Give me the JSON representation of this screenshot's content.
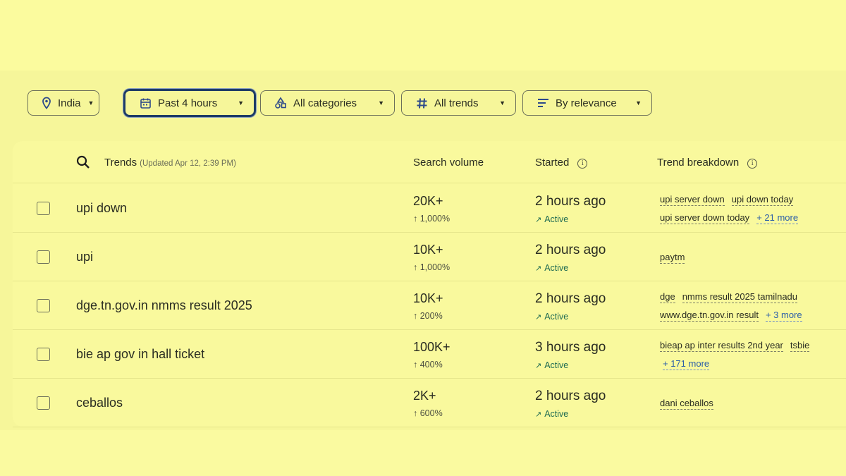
{
  "filters": {
    "location": "India",
    "time": "Past 4 hours",
    "category": "All categories",
    "trends": "All trends",
    "sort": "By relevance"
  },
  "table": {
    "headers": {
      "trends": "Trends",
      "updated": "(Updated Apr 12, 2:39 PM)",
      "search_volume": "Search volume",
      "started": "Started",
      "breakdown": "Trend breakdown"
    },
    "rows": [
      {
        "term": "upi down",
        "volume": "20K+",
        "pct": "↑ 1,000%",
        "started": "2 hours ago",
        "status": "Active",
        "breakdown_line1": [
          "upi server down",
          "upi down today"
        ],
        "breakdown_line2": [
          "upi server down today"
        ],
        "more": "+ 21 more"
      },
      {
        "term": "upi",
        "volume": "10K+",
        "pct": "↑ 1,000%",
        "started": "2 hours ago",
        "status": "Active",
        "breakdown_line1": [
          "paytm"
        ],
        "breakdown_line2": [],
        "more": ""
      },
      {
        "term": "dge.tn.gov.in nmms result 2025",
        "volume": "10K+",
        "pct": "↑ 200%",
        "started": "2 hours ago",
        "status": "Active",
        "breakdown_line1": [
          "dge",
          "nmms result 2025 tamilnadu"
        ],
        "breakdown_line2": [
          "www.dge.tn.gov.in result"
        ],
        "more": "+ 3 more"
      },
      {
        "term": "bie ap gov in hall ticket",
        "volume": "100K+",
        "pct": "↑ 400%",
        "started": "3 hours ago",
        "status": "Active",
        "breakdown_line1": [
          "bieap ap inter results 2nd year",
          "tsbie"
        ],
        "breakdown_line2": [],
        "more": "+ 171 more"
      },
      {
        "term": "ceballos",
        "volume": "2K+",
        "pct": "↑ 600%",
        "started": "2 hours ago",
        "status": "Active",
        "breakdown_line1": [
          "dani ceballos"
        ],
        "breakdown_line2": [],
        "more": ""
      }
    ]
  },
  "icons": {
    "location": "location-pin-icon",
    "time": "calendar-icon",
    "category": "category-shapes-icon",
    "trends": "hashtag-icon",
    "sort": "sort-lines-icon",
    "search": "search-icon",
    "info": "info-icon",
    "trend": "trending-up-icon"
  },
  "colors": {
    "background": "#fafaa0",
    "accent_border": "#1d3b66",
    "active_status": "#1f6b52",
    "link": "#2b5ea8"
  }
}
